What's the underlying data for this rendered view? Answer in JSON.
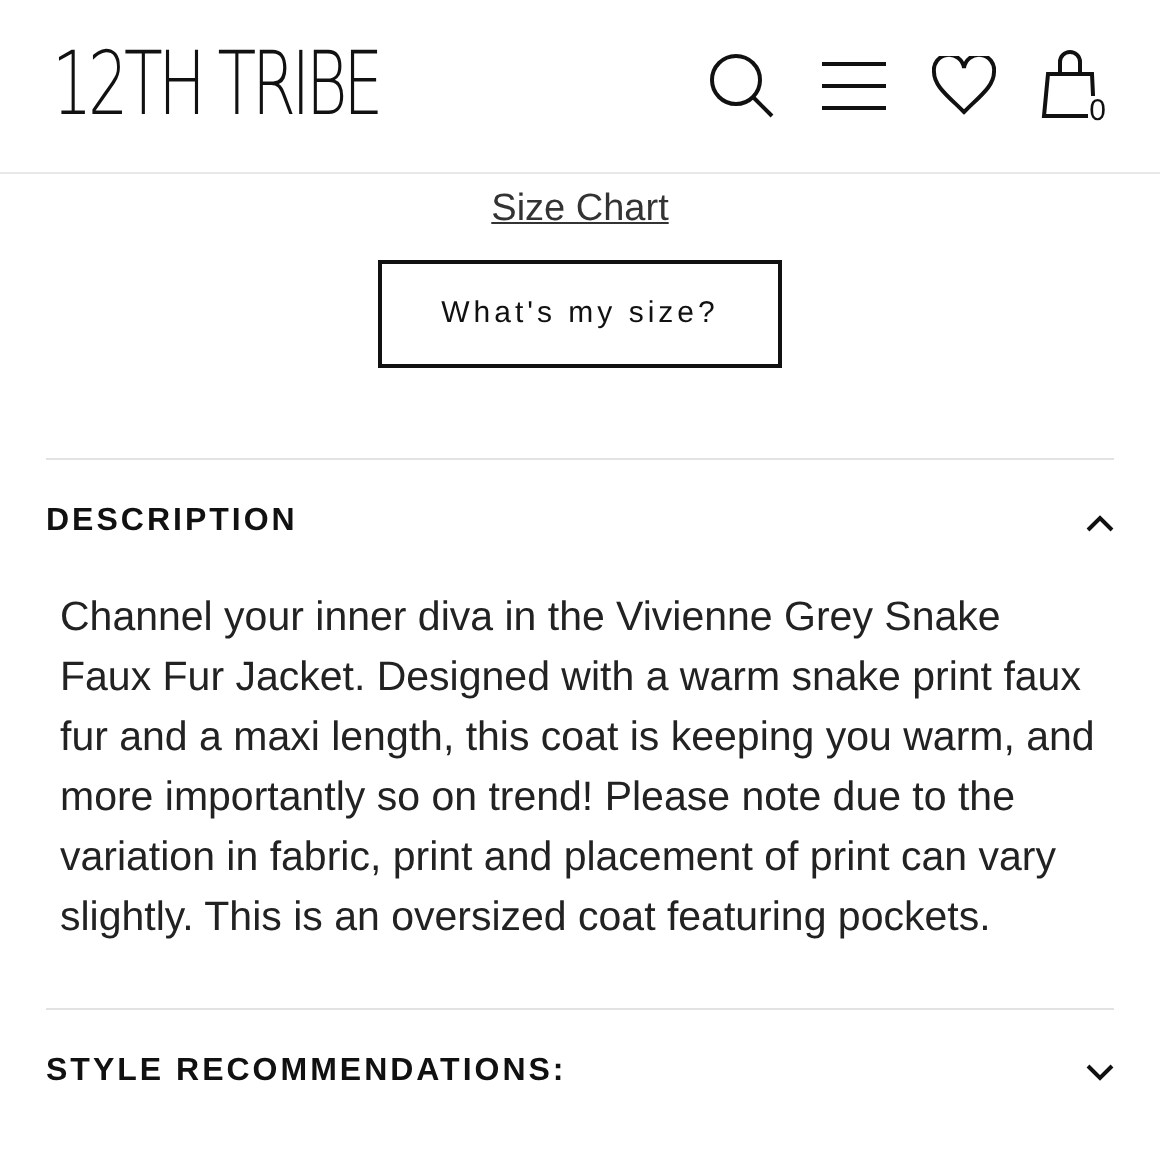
{
  "header": {
    "logo": "12TH TRIBE",
    "cart_count": "0"
  },
  "size_chart_link": "Size Chart",
  "size_button": "What's my size?",
  "sections": [
    {
      "title": "DESCRIPTION",
      "expanded": true,
      "body": "Channel your inner diva in the Vivienne Grey Snake Faux Fur Jacket. Designed with a warm snake print faux fur and a maxi length, this coat is keeping you warm, and more importantly so on trend! Please note due to the variation in fabric, print and placement of print can vary slightly. This is an oversized coat featuring pockets."
    },
    {
      "title": "STYLE RECOMMENDATIONS:",
      "expanded": false
    }
  ]
}
